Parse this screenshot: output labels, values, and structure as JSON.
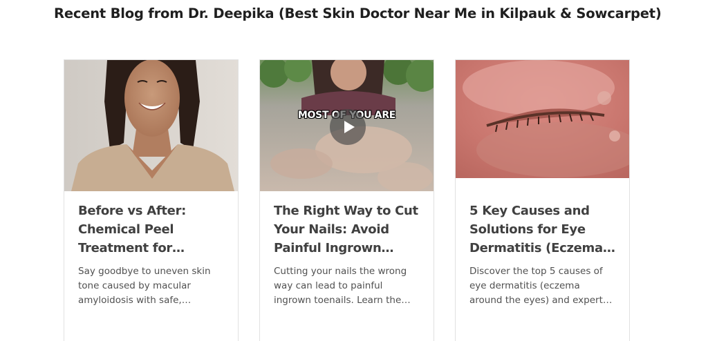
{
  "section": {
    "heading": "Recent Blog from Dr. Deepika  (Best Skin Doctor Near Me in Kilpauk & Sowcarpet)"
  },
  "posts": [
    {
      "title": "Before vs After: Chemical Peel Treatment for…",
      "excerpt": "Say goodbye to uneven skin tone caused by macular amyloidosis with safe,…",
      "image": "smiling-woman-photo"
    },
    {
      "title": "The Right Way to Cut Your Nails: Avoid Painful Ingrown…",
      "excerpt": "Cutting your nails the wrong way can lead to painful ingrown toenails. Learn the…",
      "image": "video-thumbnail",
      "video_caption": "MOST OF YOU ARE",
      "play_icon": "play-icon"
    },
    {
      "title": "5 Key Causes and Solutions for Eye Dermatitis (Eczema…",
      "excerpt": "Discover the top 5 causes of eye dermatitis (eczema around the eyes) and expert…",
      "image": "eye-dermatitis-photo"
    }
  ]
}
